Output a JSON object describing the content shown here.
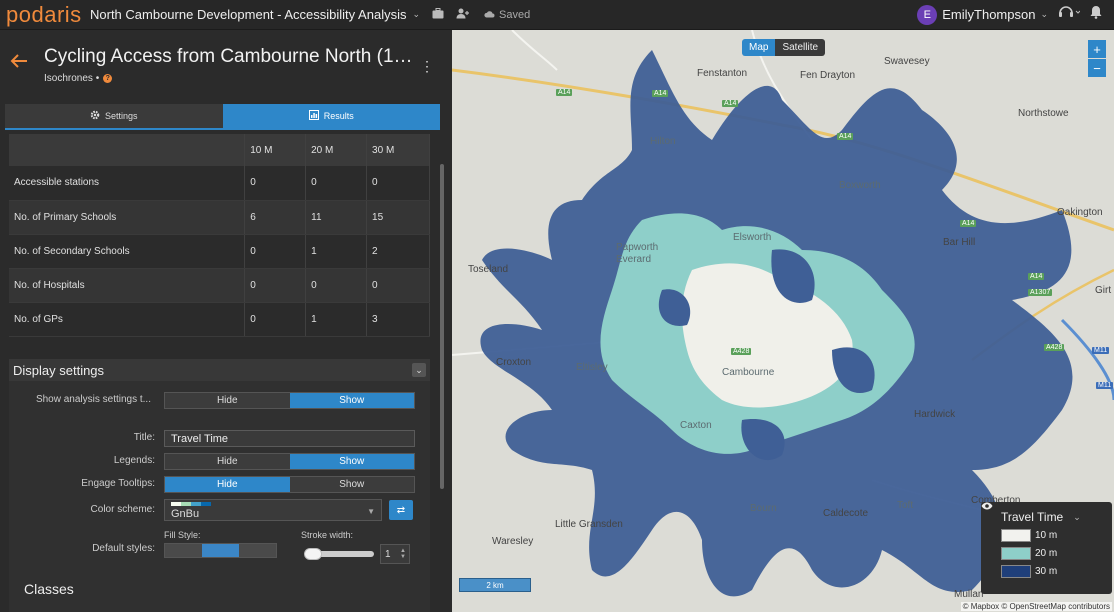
{
  "app": {
    "logo": "podaris",
    "project_title": "North Cambourne Development - Accessibility Analysis",
    "saved_label": "Saved",
    "user_initial": "E",
    "user_name": "EmilyThompson"
  },
  "panel": {
    "title": "Cycling Access from Cambourne North (10,...",
    "subtitle": "Isochrones •",
    "tabs": [
      {
        "label": "Settings",
        "icon": "gear-icon"
      },
      {
        "label": "Results",
        "icon": "bar-chart-icon"
      }
    ],
    "active_tab": "Results"
  },
  "results": {
    "columns": [
      "",
      "10 M",
      "20 M",
      "30 M"
    ],
    "rows": [
      {
        "label": "Accessible stations",
        "values": [
          "0",
          "0",
          "0"
        ]
      },
      {
        "label": "No. of Primary Schools",
        "values": [
          "6",
          "11",
          "15"
        ]
      },
      {
        "label": "No. of Secondary Schools",
        "values": [
          "0",
          "1",
          "2"
        ]
      },
      {
        "label": "No. of Hospitals",
        "values": [
          "0",
          "0",
          "0"
        ]
      },
      {
        "label": "No. of GPs",
        "values": [
          "0",
          "1",
          "3"
        ]
      }
    ]
  },
  "display_settings": {
    "header": "Display settings",
    "show_analysis_label": "Show analysis settings t...",
    "hide": "Hide",
    "show": "Show",
    "title_label": "Title:",
    "title_value": "Travel Time",
    "legends_label": "Legends:",
    "tooltips_label": "Engage Tooltips:",
    "color_scheme_label": "Color scheme:",
    "color_scheme_value": "GnBu",
    "color_scheme_swatch": [
      "#f7fcf0",
      "#a8ddb5",
      "#43a2ca",
      "#0868ac"
    ],
    "default_styles_label": "Default styles:",
    "fill_style_label": "Fill Style:",
    "stroke_width_label": "Stroke width:",
    "stroke_width_value": "1",
    "stroke_slider_fraction": 0.1,
    "classes_label": "Classes"
  },
  "map": {
    "type_options": [
      "Map",
      "Satellite"
    ],
    "active_type": "Map",
    "zoom_in": "+",
    "zoom_out": "−",
    "scale": "2 km",
    "places": [
      "Fenstanton",
      "Fen Drayton",
      "Swavesey",
      "Northstowe",
      "Oakington",
      "Hilton",
      "Boxworth",
      "Elsworth",
      "Papworth Everard",
      "Bar Hill",
      "Toseland",
      "Croxton",
      "Eltisley",
      "Cambourne",
      "Hardwick",
      "Caxton",
      "Bourn",
      "Caldecote",
      "Toft",
      "Comberton",
      "Little Gransden",
      "Waresley",
      "Girt",
      "Mullan"
    ],
    "roads": [
      "A14",
      "A14",
      "A14",
      "A14",
      "A14",
      "A14",
      "A1307",
      "A428",
      "M11",
      "M11",
      "A428"
    ],
    "legend": {
      "title": "Travel Time",
      "items": [
        {
          "label": "10 m",
          "color": "#f2f2ee"
        },
        {
          "label": "20 m",
          "color": "#8ecfc9"
        },
        {
          "label": "30 m",
          "color": "#1f3f7a"
        }
      ]
    },
    "attribution": "© Mapbox © OpenStreetMap contributors"
  }
}
